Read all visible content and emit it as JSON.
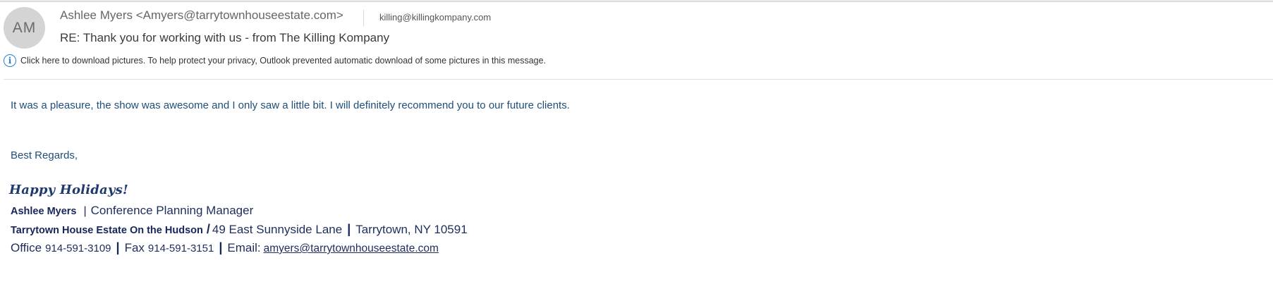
{
  "header": {
    "avatar_initials": "AM",
    "sender": "Ashlee Myers <Amyers@tarrytownhouseestate.com>",
    "to": "killing@killingkompany.com",
    "subject": "RE: Thank you for working with us - from The Killing Kompany",
    "info_icon": "info-circle-icon",
    "info_bar_text": "Click here to download pictures. To help protect your privacy, Outlook prevented automatic download of some pictures in this message."
  },
  "body": {
    "paragraph1": "It was a pleasure, the show was awesome and I only saw a little bit. I will definitely recommend you to our future clients.",
    "closing": "Best Regards,"
  },
  "signature": {
    "greeting": "Happy Holidays!",
    "name": "Ashlee Myers",
    "separator": "|",
    "title": "Conference Planning Manager",
    "company": "Tarrytown House Estate On the Hudson",
    "company_separator": "/",
    "street": "49 East Sunnyside Lane",
    "city": "Tarrytown, NY 10591",
    "office_label": "Office",
    "office_phone": "914-591-3109",
    "fax_label": "Fax",
    "fax_phone": "914-591-3151",
    "email_label": "Email:",
    "email": "amyers@tarrytownhouseestate.com"
  },
  "colors": {
    "body_text": "#1f4e79",
    "signature_text": "#1f2d5c",
    "info_icon": "#2c7fc7",
    "avatar_bg": "#d4d4d4"
  }
}
